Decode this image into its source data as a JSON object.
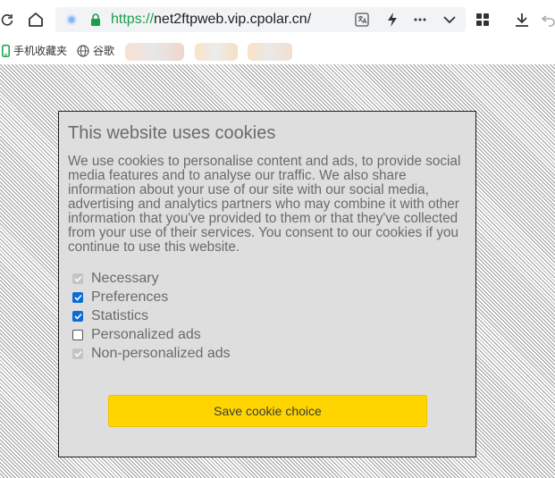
{
  "browser": {
    "url_scheme": "https://",
    "url_rest": "net2ftpweb.vip.cpolar.cn/",
    "bookmarks": [
      {
        "label": "手机收藏夹",
        "icon": "phone-icon"
      },
      {
        "label": "谷歌",
        "icon": "globe-icon"
      }
    ]
  },
  "cookie_dialog": {
    "title": "This website uses cookies",
    "body": "We use cookies to personalise content and ads, to provide social media features and to analyse our traffic. We also share information about your use of our site with our social media, advertising and analytics partners who may combine it with other information that you've provided to them or that they've collected from your use of their services. You consent to our cookies if you continue to use this website.",
    "options": [
      {
        "label": "Necessary",
        "checked": true,
        "disabled": true
      },
      {
        "label": "Preferences",
        "checked": true,
        "disabled": false
      },
      {
        "label": "Statistics",
        "checked": true,
        "disabled": false
      },
      {
        "label": "Personalized ads",
        "checked": false,
        "disabled": false
      },
      {
        "label": "Non-personalized ads",
        "checked": true,
        "disabled": true
      }
    ],
    "save_label": "Save cookie choice"
  },
  "colors": {
    "accent_button": "#ffd500",
    "checkbox_checked": "#0b6cd6",
    "secure_green": "#1a9e4b"
  }
}
